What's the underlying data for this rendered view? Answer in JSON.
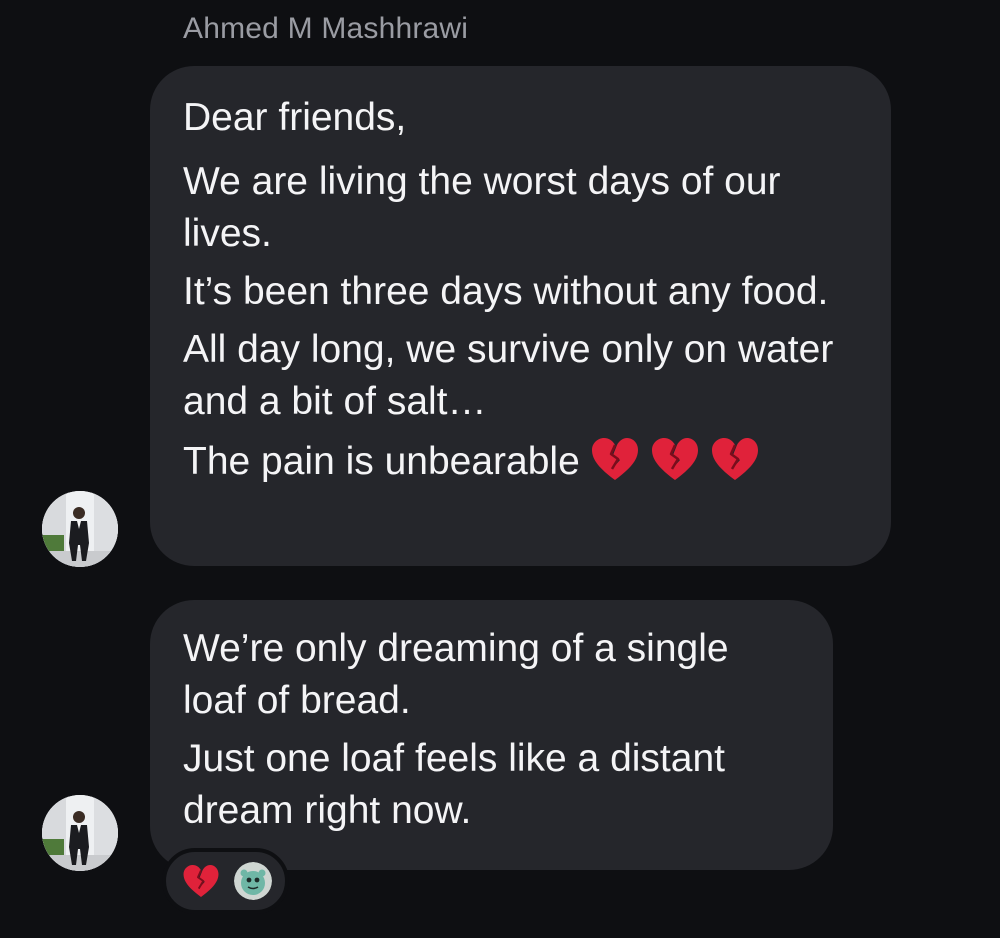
{
  "conversation": {
    "sender_name": "Ahmed M Mashhrawi",
    "messages": [
      {
        "lines": [
          "Dear friends,",
          "We are living the worst days of our lives.",
          "It’s been three days without any food.",
          "All day long, we survive only on water and a bit of salt…",
          "The pain is unbearable"
        ],
        "trailing_emoji": [
          "broken-heart-icon",
          "broken-heart-icon",
          "broken-heart-icon"
        ]
      },
      {
        "lines": [
          "We’re only dreaming of a single loaf of bread.",
          "Just one loaf feels like a distant dream right now."
        ],
        "reactions": [
          "broken-heart-icon",
          "reactor-avatar"
        ]
      }
    ]
  },
  "colors": {
    "background": "#0e0f12",
    "bubble": "#25262b",
    "sender_name": "#9a9ca3",
    "text": "#f4f4f6",
    "broken_heart": "#e0223a"
  }
}
